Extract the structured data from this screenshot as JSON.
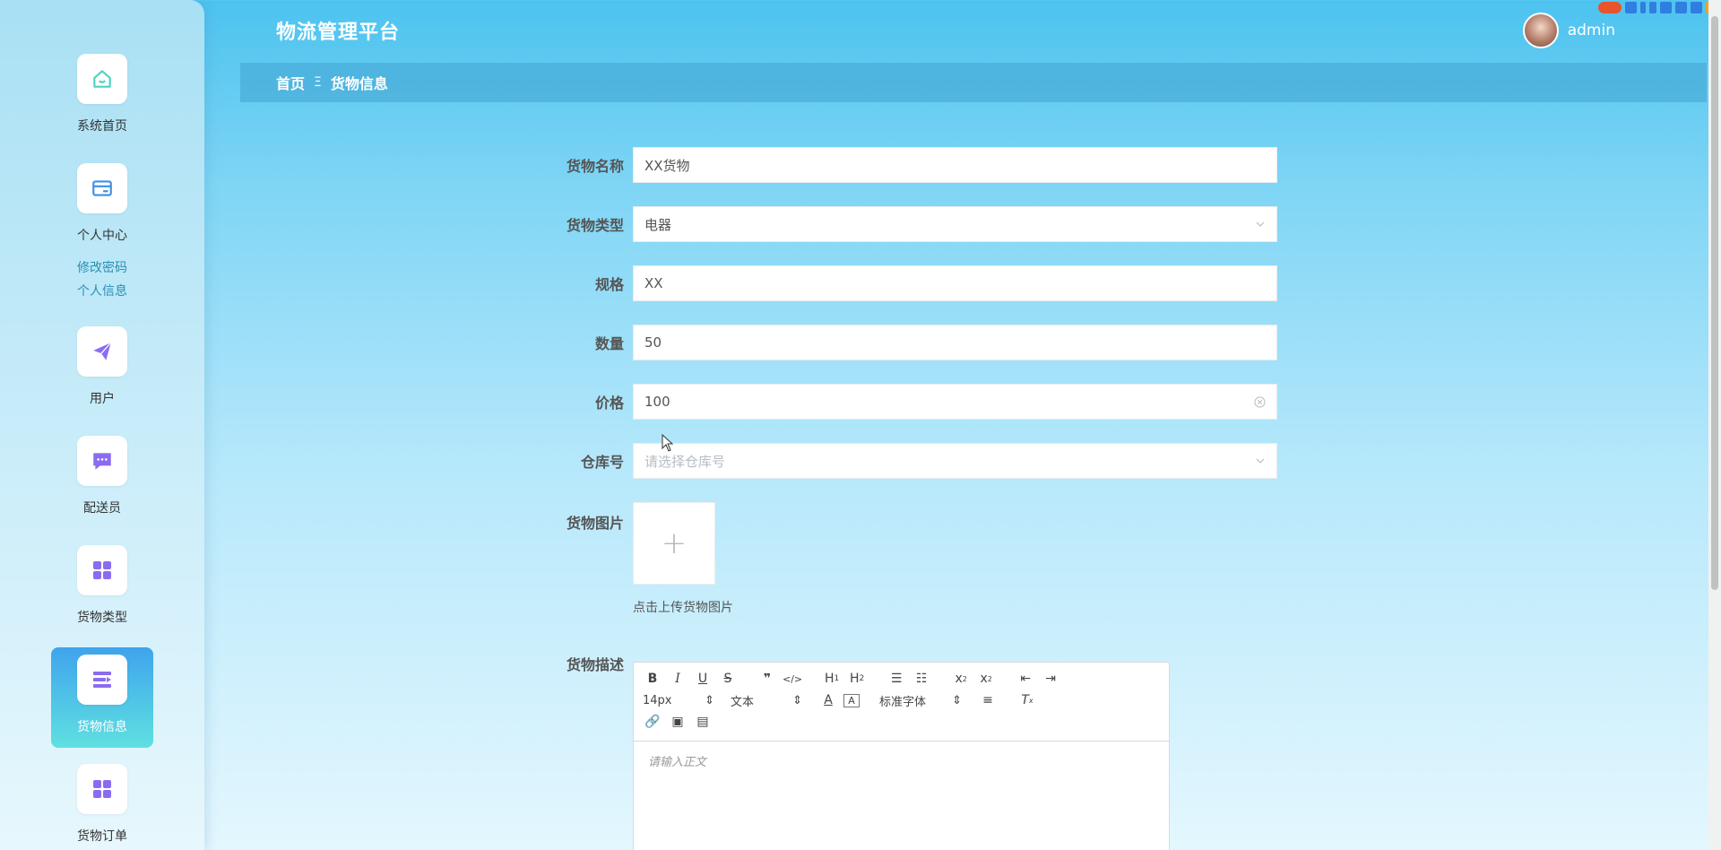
{
  "app": {
    "title": "物流管理平台"
  },
  "user": {
    "name": "admin"
  },
  "breadcrumb": {
    "home": "首页",
    "separator": "Ξ",
    "current": "货物信息"
  },
  "sidebar": {
    "items": [
      {
        "label": "系统首页",
        "icon": "home-icon"
      },
      {
        "label": "个人中心",
        "icon": "card-icon",
        "children": [
          "修改密码",
          "个人信息"
        ]
      },
      {
        "label": "用户",
        "icon": "paper-plane-icon"
      },
      {
        "label": "配送员",
        "icon": "chat-bubble-icon"
      },
      {
        "label": "货物类型",
        "icon": "grid-icon"
      },
      {
        "label": "货物信息",
        "icon": "list-icon",
        "active": true
      },
      {
        "label": "货物订单",
        "icon": "grid-icon"
      }
    ]
  },
  "form": {
    "name": {
      "label": "货物名称",
      "value": "XX货物"
    },
    "type": {
      "label": "货物类型",
      "value": "电器"
    },
    "spec": {
      "label": "规格",
      "value": "XX"
    },
    "quantity": {
      "label": "数量",
      "value": "50"
    },
    "price": {
      "label": "价格",
      "value": "100"
    },
    "warehouse": {
      "label": "仓库号",
      "placeholder": "请选择仓库号"
    },
    "image": {
      "label": "货物图片",
      "hint": "点击上传货物图片"
    },
    "description": {
      "label": "货物描述",
      "font_size": "14px",
      "block_type": "文本",
      "font_family": "标准字体",
      "placeholder": "请输入正文"
    }
  },
  "colors": {
    "accent": "#3fa4ec",
    "menu_icon": "#8b6cf0",
    "submenu": "#2a8fb6"
  }
}
